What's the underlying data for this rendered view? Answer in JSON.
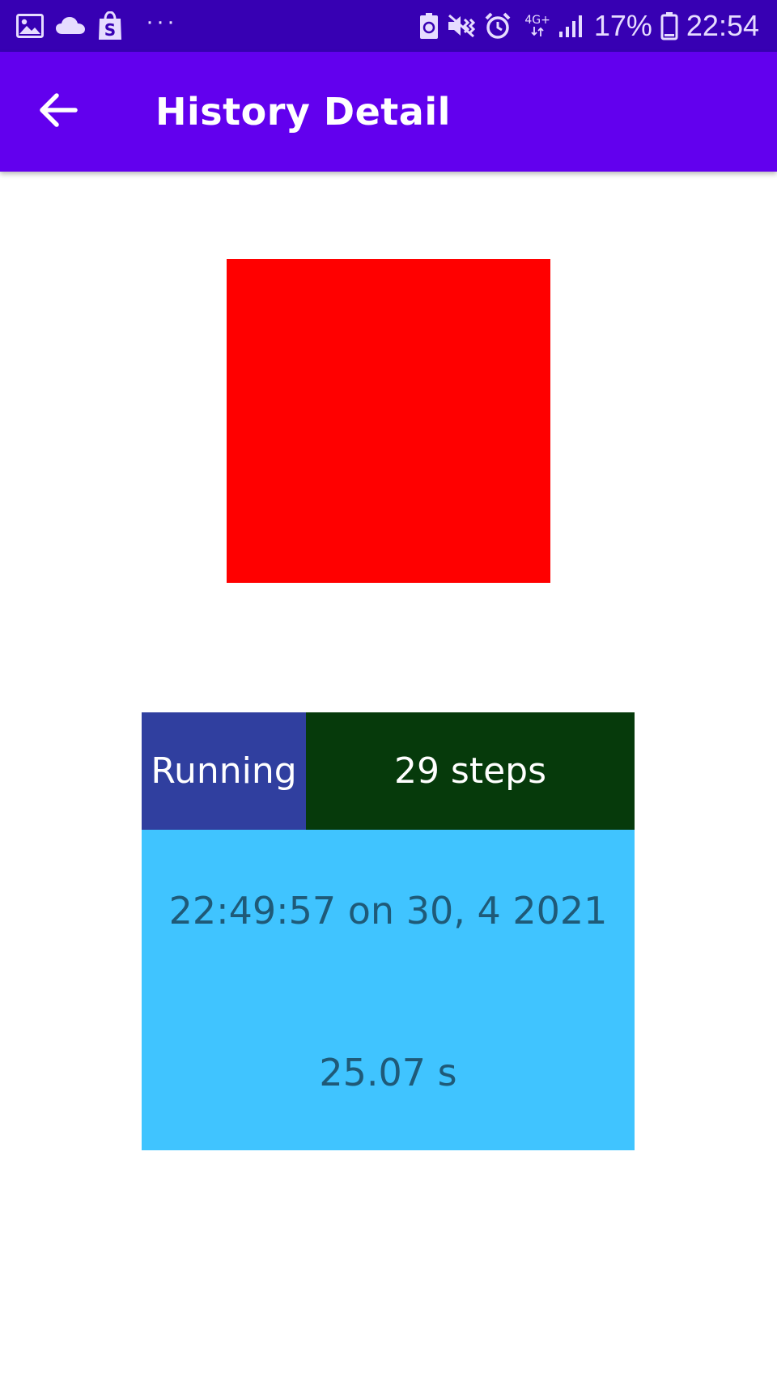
{
  "status_bar": {
    "battery_percent": "17%",
    "time": "22:54",
    "network_type": "4G+",
    "overflow_dots": "···",
    "left_icons": [
      "gallery-icon",
      "cloud-icon",
      "shopping-bag-icon"
    ],
    "right_icons": [
      "battery-saver-icon",
      "mute-vibrate-icon",
      "alarm-icon",
      "signal-icon",
      "battery-icon"
    ]
  },
  "app_bar": {
    "title": "History Detail",
    "back_icon": "arrow-back-icon",
    "background_color": "#6200ee"
  },
  "activity": {
    "image_color": "#ff0000",
    "type": "Running",
    "steps": "29 steps",
    "timestamp": "22:49:57 on 30, 4 2021",
    "duration": "25.07 s"
  },
  "colors": {
    "status_bar": "#3700b3",
    "type_cell": "#303f9f",
    "steps_cell": "#063a0b",
    "details_panel": "#40c4ff",
    "details_text": "#1f5a78"
  }
}
